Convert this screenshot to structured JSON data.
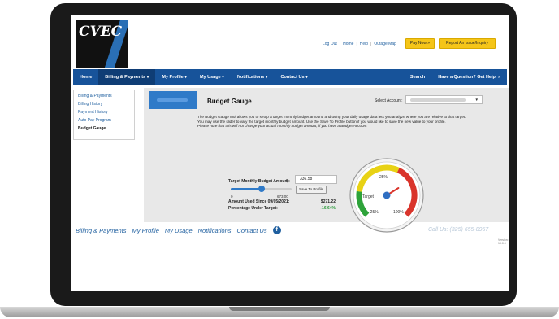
{
  "brand": {
    "logo_text": "CVEC",
    "colors": {
      "nav": "#17539a",
      "nav_active": "#0f3d75",
      "accent_yellow": "#f5c518",
      "link": "#1f5f9f",
      "panel_bg": "#e8e8e8"
    }
  },
  "header": {
    "links": [
      "Log Out",
      "Home",
      "Help",
      "Outage Map"
    ],
    "pay_now": "Pay Now »",
    "report_issue": "Report An Issue/Inquiry"
  },
  "nav": {
    "items": [
      {
        "label": "Home",
        "icon": ""
      },
      {
        "label": "Billing & Payments ▾",
        "active": true
      },
      {
        "label": "My Profile ▾"
      },
      {
        "label": "My Usage ▾"
      },
      {
        "label": "Notifications ▾"
      },
      {
        "label": "Contact Us ▾"
      }
    ],
    "search": "Search",
    "help": "Have a Question? Get Help. »"
  },
  "sidebar": {
    "items": [
      "Billing & Payments",
      "Billing History",
      "Payment History",
      "Auto Pay Program",
      "Budget Gauge"
    ],
    "current_index": 4
  },
  "panel": {
    "title": "Budget Gauge",
    "select_account_label": "Select Account:",
    "description": [
      "The Budget Gauge tool allows you to setup a target monthly budget amount, and using your daily usage data lets you analyze where you are relative to that target.",
      "You may use the slider to vary the target monthly budget amount. Use the Save To Profile button if you would like to save the new value to your profile."
    ],
    "note": "Please note that this will not change your actual monthly budget amount, if you have a Budget Account",
    "target_label": "Target Monthly Budget Amount:",
    "currency": "$",
    "target_value": "336.58",
    "save_button": "Save To Profile",
    "slider": {
      "min": "0",
      "max": "673.00",
      "fraction": 0.5
    },
    "amount_used_label": "Amount Used Since 09/05/2021:",
    "amount_used_value": "$271.22",
    "percent_under_label": "Percentage Under Target:",
    "percent_under_value": "-16.64%"
  },
  "gauge": {
    "label": "Target",
    "tick_25": "25%",
    "tick_neg25": "-25%",
    "tick_100": "100%",
    "reading": -0.1664
  },
  "footer": {
    "links": [
      "Billing & Payments",
      "My Profile",
      "My Usage",
      "Notifications",
      "Contact Us"
    ],
    "facebook": "f",
    "call_us": "Call Us: (325) 655-8957",
    "version": "Version: 10.0.0"
  }
}
